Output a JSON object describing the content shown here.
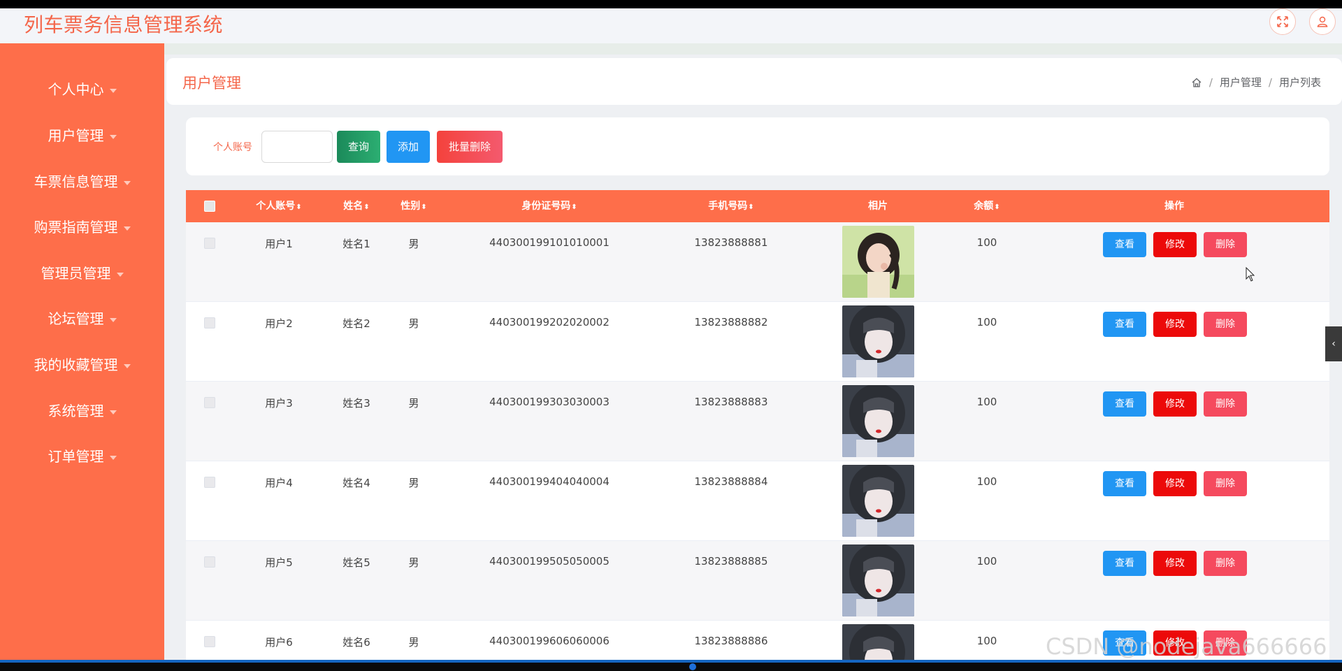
{
  "app": {
    "title": "列车票务信息管理系统"
  },
  "topbar": {
    "fullscreen_icon": "expand-icon",
    "user_icon": "user-icon"
  },
  "sidebar": {
    "items": [
      {
        "label": "个人中心"
      },
      {
        "label": "用户管理"
      },
      {
        "label": "车票信息管理"
      },
      {
        "label": "购票指南管理"
      },
      {
        "label": "管理员管理"
      },
      {
        "label": "论坛管理"
      },
      {
        "label": "我的收藏管理"
      },
      {
        "label": "系统管理"
      },
      {
        "label": "订单管理"
      }
    ]
  },
  "header": {
    "title": "用户管理",
    "breadcrumb": [
      "用户管理",
      "用户列表"
    ],
    "breadcrumb_sep": "/"
  },
  "search": {
    "label": "个人账号",
    "input_value": "",
    "query_label": "查询",
    "add_label": "添加",
    "batch_delete_label": "批量删除"
  },
  "table": {
    "columns": {
      "account": "个人账号",
      "name": "姓名",
      "gender": "性别",
      "idcard": "身份证号码",
      "phone": "手机号码",
      "photo": "相片",
      "balance": "余额",
      "actions": "操作"
    },
    "sort_glyph": "⬍",
    "action_labels": {
      "view": "查看",
      "edit": "修改",
      "delete": "删除"
    },
    "rows": [
      {
        "account": "用户1",
        "name": "姓名1",
        "gender": "男",
        "idcard": "440300199101010001",
        "phone": "13823888881",
        "balance": "100"
      },
      {
        "account": "用户2",
        "name": "姓名2",
        "gender": "男",
        "idcard": "440300199202020002",
        "phone": "13823888882",
        "balance": "100"
      },
      {
        "account": "用户3",
        "name": "姓名3",
        "gender": "男",
        "idcard": "440300199303030003",
        "phone": "13823888883",
        "balance": "100"
      },
      {
        "account": "用户4",
        "name": "姓名4",
        "gender": "男",
        "idcard": "440300199404040004",
        "phone": "13823888884",
        "balance": "100"
      },
      {
        "account": "用户5",
        "name": "姓名5",
        "gender": "男",
        "idcard": "440300199505050005",
        "phone": "13823888885",
        "balance": "100"
      },
      {
        "account": "用户6",
        "name": "姓名6",
        "gender": "男",
        "idcard": "440300199606060006",
        "phone": "13823888886",
        "balance": "100"
      }
    ]
  },
  "watermark": "CSDN @nodejava666666",
  "colors": {
    "accent": "#fe6e4a",
    "primary": "#2196f3",
    "danger": "#ec0a0a",
    "success": "#1b8a5a"
  }
}
